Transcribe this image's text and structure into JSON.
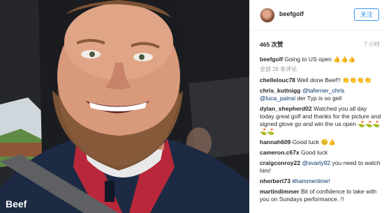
{
  "post": {
    "username": "beefgolf",
    "follow_label": "关注",
    "likes": "465 次赞",
    "time": "7 小时",
    "caption_user": "beefgolf",
    "caption_text": "Going to US open",
    "caption_emoji": "👍👍👍",
    "view_all": "全部 28 条评论",
    "shirt_text": "Beef"
  },
  "comments": [
    {
      "user": "chellelouc78",
      "text": "Well done Beef!!",
      "emoji": "👏👏👏👏"
    },
    {
      "user": "chris_kuttnigg",
      "mention": "@taferner_chris",
      "user2_mention": "@luca_painsi",
      "text": "der Typ is so geil"
    },
    {
      "user": "dylan_shepherd02",
      "text": "Watched you all day today great golf and thanks for the picture and signed glove go and win the us open",
      "emoji": "⛳⛳⛳⛳⛳"
    },
    {
      "user": "hannah609",
      "text": "Good luck",
      "emoji": "😊👍"
    },
    {
      "user": "cameron.c67x",
      "text": "Good luck"
    },
    {
      "user": "craigconroy22",
      "mention": "@svarty92",
      "text": "you need to watch him!"
    },
    {
      "user": "nherbert73",
      "mention": "#hammertime!",
      "text": ""
    },
    {
      "user": "martindimmer",
      "text": "Bit of confidence to take with you on Sundays performance. !!"
    }
  ],
  "icons": {
    "avatar": "profile-avatar"
  }
}
